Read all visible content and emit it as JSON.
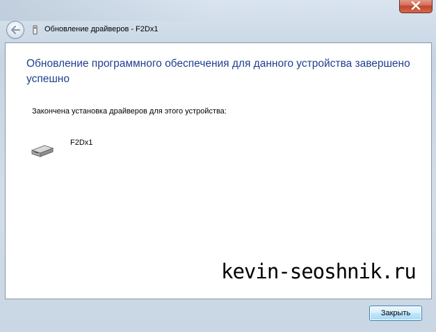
{
  "titlebar": {
    "close_icon": "close-x-icon"
  },
  "nav": {
    "back_icon": "back-arrow-icon",
    "device_icon": "usb-device-icon",
    "title": "Обновление драйверов - F2Dx1"
  },
  "main": {
    "headline": "Обновление программного обеспечения для данного устройства завершено успешно",
    "subline": "Закончена установка драйверов для этого устройства:",
    "device": {
      "icon": "drive-icon",
      "name": "F2Dx1"
    }
  },
  "overlay": {
    "watermark": "kevin-seoshnik.ru"
  },
  "footer": {
    "close_label": "Закрыть"
  },
  "colors": {
    "headline": "#1e3f8f",
    "window_close": "#c3462e",
    "button_border": "#3c7fb1"
  }
}
